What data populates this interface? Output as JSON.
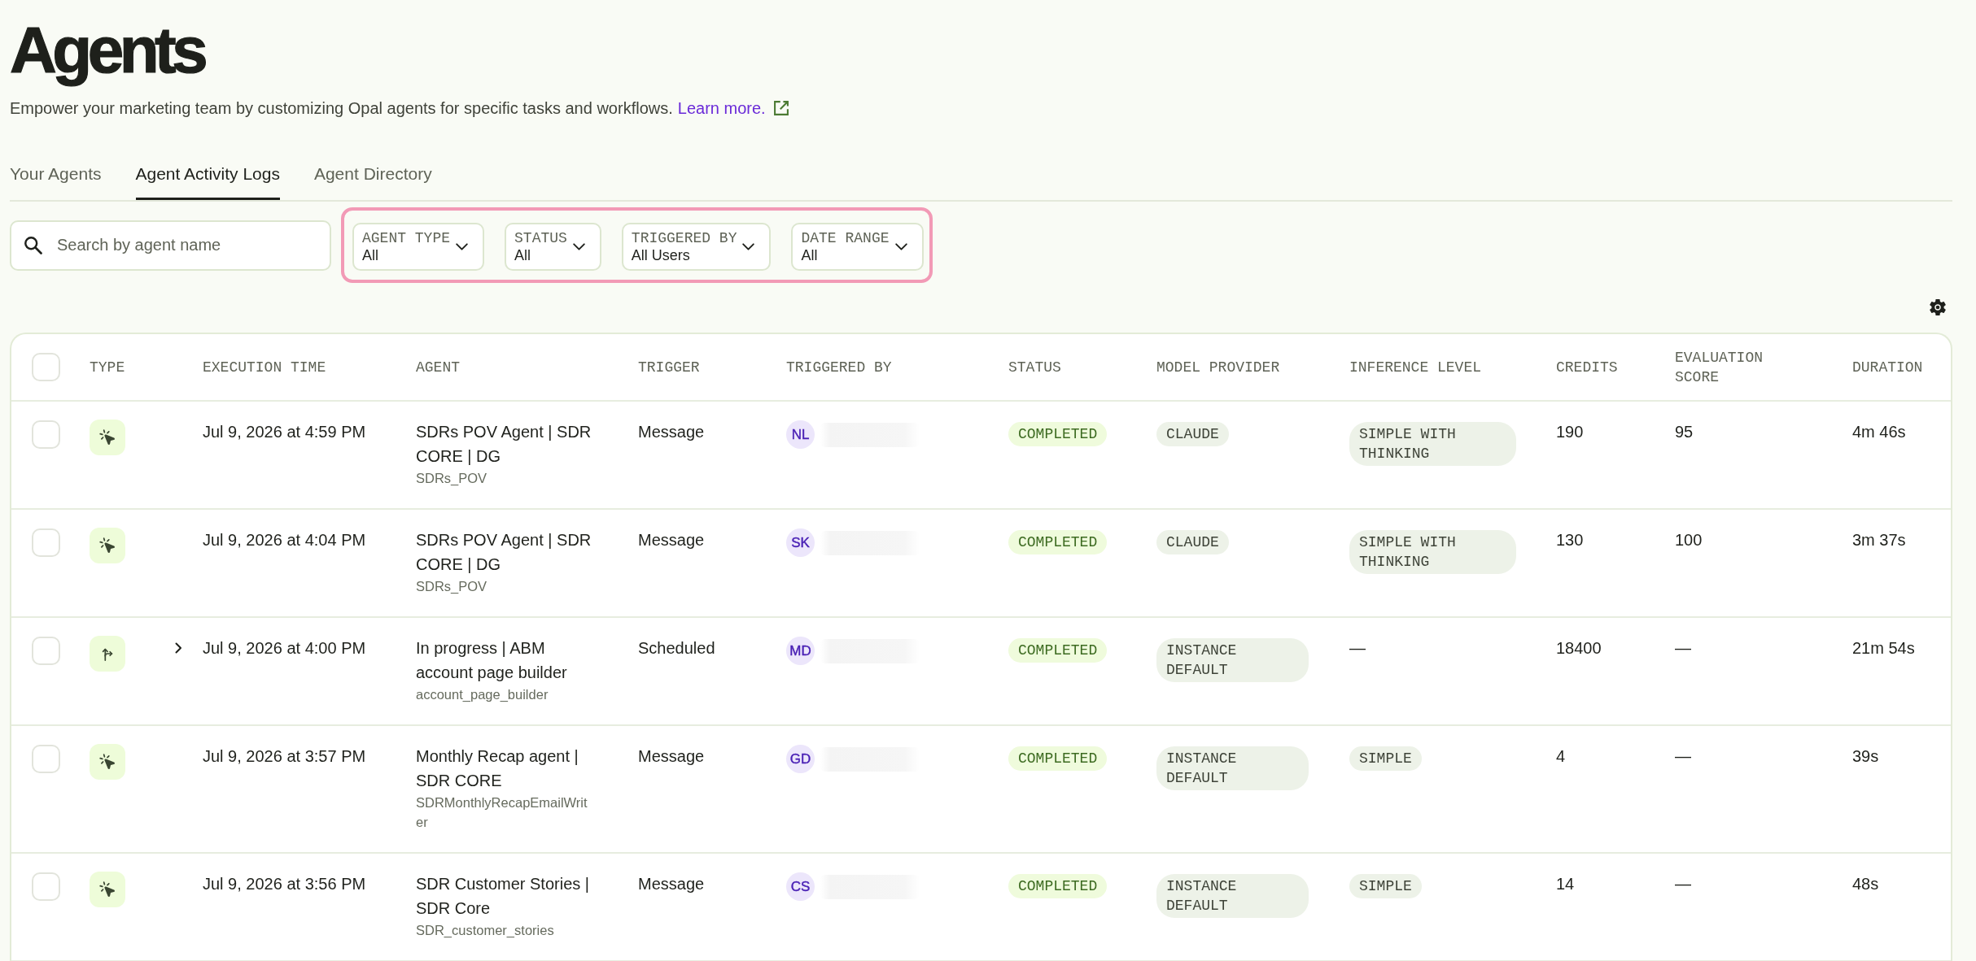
{
  "header": {
    "title": "Agents",
    "description": "Empower your marketing team by customizing Opal agents for specific tasks and workflows.",
    "link": "Learn more."
  },
  "tabs": [
    {
      "label": "Your Agents",
      "selected": false
    },
    {
      "label": "Agent Activity Logs",
      "selected": true
    },
    {
      "label": "Agent Directory",
      "selected": false
    }
  ],
  "search": {
    "placeholder": "Search by agent name"
  },
  "filter_bar": {
    "highlighted": true,
    "filters": [
      {
        "label": "AGENT TYPE",
        "value": "All"
      },
      {
        "label": "STATUS",
        "value": "All"
      },
      {
        "label": "TRIGGERED BY",
        "value": "All Users"
      },
      {
        "label": "DATE RANGE",
        "value": "All"
      }
    ]
  },
  "table": {
    "select_all": {
      "checked": false
    },
    "columns": [
      "TYPE",
      "EXECUTION TIME",
      "AGENT",
      "TRIGGER",
      "TRIGGERED BY",
      "STATUS",
      "MODEL PROVIDER",
      "INFERENCE LEVEL",
      "CREDITS",
      "EVALUATION SCORE",
      "DURATION"
    ],
    "rows": [
      {
        "checked": false,
        "kind": "agent",
        "execution_time": "Jul 9, 2026 at 4:59 PM",
        "agent_name": "SDRs POV Agent | SDR CORE | DG",
        "agent_id": "SDRs_POV",
        "trigger": "Message",
        "user_initials": "NL",
        "status": "COMPLETED",
        "model_provider": "CLAUDE",
        "inference_level": {
          "kind": "pill",
          "text": "SIMPLE WITH THINKING"
        },
        "credits": "190",
        "evaluation_score": "95",
        "duration": "4m 46s"
      },
      {
        "checked": false,
        "kind": "agent",
        "execution_time": "Jul 9, 2026 at 4:04 PM",
        "agent_name": "SDRs POV Agent | SDR CORE | DG",
        "agent_id": "SDRs_POV",
        "trigger": "Message",
        "user_initials": "SK",
        "status": "COMPLETED",
        "model_provider": "CLAUDE",
        "inference_level": {
          "kind": "pill",
          "text": "SIMPLE WITH THINKING"
        },
        "credits": "130",
        "evaluation_score": "100",
        "duration": "3m 37s"
      },
      {
        "checked": false,
        "kind": "workflow",
        "expanded": false,
        "execution_time": "Jul 9, 2026 at 4:00 PM",
        "agent_name": "In progress | ABM account page builder",
        "agent_id": "account_page_builder",
        "trigger": "Scheduled",
        "user_initials": "MD",
        "status": "COMPLETED",
        "model_provider": "INSTANCE DEFAULT",
        "inference_level": {
          "kind": "plain",
          "text": "—"
        },
        "credits": "18400",
        "evaluation_score": "—",
        "duration": "21m 54s"
      },
      {
        "checked": false,
        "kind": "agent",
        "execution_time": "Jul 9, 2026 at 3:57 PM",
        "agent_name": "Monthly Recap agent | SDR CORE",
        "agent_id": "SDRMonthlyRecapEmailWriter",
        "trigger": "Message",
        "user_initials": "GD",
        "status": "COMPLETED",
        "model_provider": "INSTANCE DEFAULT",
        "inference_level": {
          "kind": "pill",
          "text": "SIMPLE"
        },
        "credits": "4",
        "evaluation_score": "—",
        "duration": "39s"
      },
      {
        "checked": false,
        "kind": "agent",
        "execution_time": "Jul 9, 2026 at 3:56 PM",
        "agent_name": "SDR Customer Stories | SDR Core",
        "agent_id": "SDR_customer_stories",
        "trigger": "Message",
        "user_initials": "CS",
        "status": "COMPLETED",
        "model_provider": "INSTANCE DEFAULT",
        "inference_level": {
          "kind": "pill",
          "text": "SIMPLE"
        },
        "credits": "14",
        "evaluation_score": "—",
        "duration": "48s"
      }
    ]
  }
}
